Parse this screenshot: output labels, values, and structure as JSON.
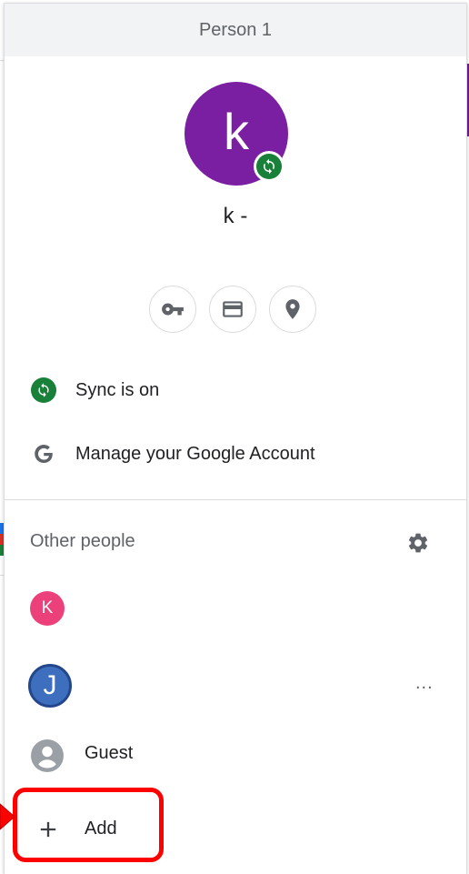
{
  "header": {
    "title": "Person 1"
  },
  "profile": {
    "avatar_letter": "k",
    "name": "k -",
    "avatar_color": "#7b1fa2",
    "sync_badge_color": "#188038"
  },
  "quick_actions": [
    {
      "icon": "key-icon",
      "label": "Passwords"
    },
    {
      "icon": "credit-card-icon",
      "label": "Payment methods"
    },
    {
      "icon": "location-pin-icon",
      "label": "Addresses"
    }
  ],
  "menu": {
    "sync_label": "Sync is on",
    "manage_account_label": "Manage your Google Account"
  },
  "other_people": {
    "title": "Other people",
    "people": [
      {
        "letter": "K",
        "color": "#ec407a"
      },
      {
        "letter": "J",
        "color": "#3e6fbf",
        "more": "..."
      }
    ],
    "guest_label": "Guest",
    "add_label": "Add"
  },
  "annotation": {
    "highlight_color": "#ff0000"
  }
}
